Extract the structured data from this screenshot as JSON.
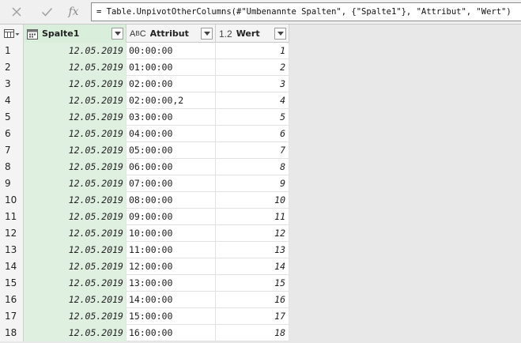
{
  "formula_bar": {
    "cancel_icon": "cross-icon",
    "ok_icon": "checkmark-icon",
    "fx_label": "fx",
    "formula": "= Table.UnpivotOtherColumns(#\"Umbenannte Spalten\", {\"Spalte1\"}, \"Attribut\", \"Wert\")"
  },
  "grid": {
    "corner_icon": "table-menu-icon",
    "columns": [
      {
        "name": "Spalte1",
        "type_icon": "calendar-icon"
      },
      {
        "name": "Attribut",
        "type_icon": "abc-text-icon",
        "type_label_a": "A",
        "type_label_b": "B",
        "type_label_c": "C"
      },
      {
        "name": "Wert",
        "type_icon": "decimal-number-icon",
        "type_label": "1.2"
      }
    ],
    "rows": [
      {
        "idx": "1",
        "date": "12.05.2019",
        "attr": "00:00:00",
        "val": "1"
      },
      {
        "idx": "2",
        "date": "12.05.2019",
        "attr": "01:00:00",
        "val": "2"
      },
      {
        "idx": "3",
        "date": "12.05.2019",
        "attr": "02:00:00",
        "val": "3"
      },
      {
        "idx": "4",
        "date": "12.05.2019",
        "attr": "02:00:00,2",
        "val": "4"
      },
      {
        "idx": "5",
        "date": "12.05.2019",
        "attr": "03:00:00",
        "val": "5"
      },
      {
        "idx": "6",
        "date": "12.05.2019",
        "attr": "04:00:00",
        "val": "6"
      },
      {
        "idx": "7",
        "date": "12.05.2019",
        "attr": "05:00:00",
        "val": "7"
      },
      {
        "idx": "8",
        "date": "12.05.2019",
        "attr": "06:00:00",
        "val": "8"
      },
      {
        "idx": "9",
        "date": "12.05.2019",
        "attr": "07:00:00",
        "val": "9"
      },
      {
        "idx": "10",
        "date": "12.05.2019",
        "attr": "08:00:00",
        "val": "10"
      },
      {
        "idx": "11",
        "date": "12.05.2019",
        "attr": "09:00:00",
        "val": "11"
      },
      {
        "idx": "12",
        "date": "12.05.2019",
        "attr": "10:00:00",
        "val": "12"
      },
      {
        "idx": "13",
        "date": "12.05.2019",
        "attr": "11:00:00",
        "val": "13"
      },
      {
        "idx": "14",
        "date": "12.05.2019",
        "attr": "12:00:00",
        "val": "14"
      },
      {
        "idx": "15",
        "date": "12.05.2019",
        "attr": "13:00:00",
        "val": "15"
      },
      {
        "idx": "16",
        "date": "12.05.2019",
        "attr": "14:00:00",
        "val": "16"
      },
      {
        "idx": "17",
        "date": "12.05.2019",
        "attr": "15:00:00",
        "val": "17"
      },
      {
        "idx": "18",
        "date": "12.05.2019",
        "attr": "16:00:00",
        "val": "18"
      }
    ]
  },
  "colors": {
    "selected_column_bg": "#dff0e1",
    "selected_header_bg": "#d9eedb",
    "header_bg": "#f4f4f4",
    "canvas_bg": "#e8e8e8"
  }
}
